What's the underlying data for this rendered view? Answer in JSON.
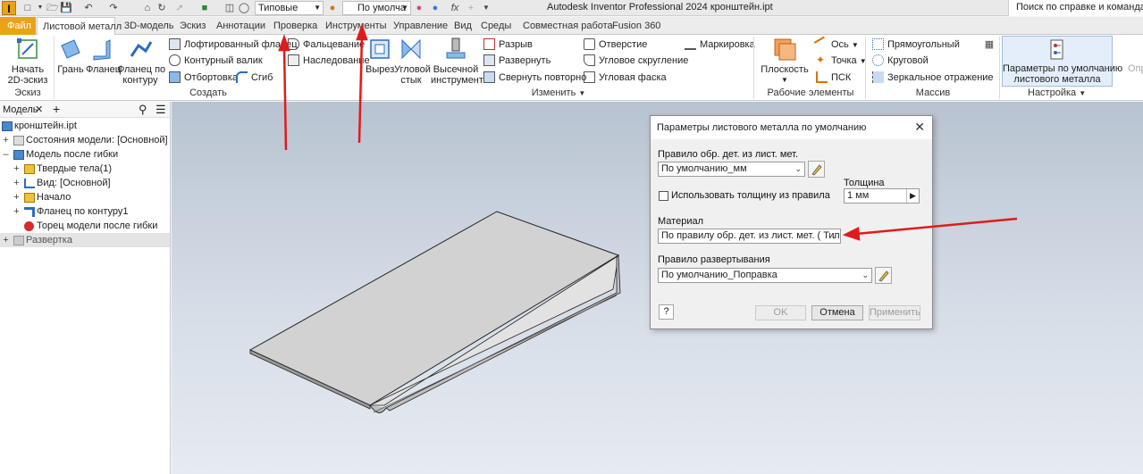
{
  "quick_access": {
    "logo": "I",
    "appearance_value": "Типовые",
    "material_value": "По умолча",
    "title": "Autodesk Inventor Professional 2024   кронштейн.ipt",
    "help_search": "Поиск по справке и командам."
  },
  "tabs": [
    {
      "label": "Файл"
    },
    {
      "label": "Листовой металл"
    },
    {
      "label": "3D-модель"
    },
    {
      "label": "Эскиз"
    },
    {
      "label": "Аннотации"
    },
    {
      "label": "Проверка"
    },
    {
      "label": "Инструменты"
    },
    {
      "label": "Управление"
    },
    {
      "label": "Вид"
    },
    {
      "label": "Среды"
    },
    {
      "label": "Совместная работа"
    },
    {
      "label": "Fusion 360"
    }
  ],
  "ribbon": {
    "sketch_panel": {
      "start_sketch": "Начать\n2D-эскиз",
      "label": "Эскиз"
    },
    "create_panel": {
      "label": "Создать",
      "face": "Грань",
      "flange": "Фланец",
      "contour_flange": "Фланец по\nконтуру",
      "lofted_flange": "Лофтированный фланец",
      "contour_roll": "Контурный валик",
      "rip": "Отбортовка",
      "bend": "Сгиб",
      "hem": "Фальцевание",
      "derive": "Наследование"
    },
    "modify_panel": {
      "label": "Изменить",
      "cut": "Вырез",
      "corner_seam": "Угловой\nстык",
      "punch_tool": "Высечной\nинструмент",
      "rip": "Разрыв",
      "unfold": "Развернуть",
      "refold": "Свернуть повторно",
      "hole": "Отверстие",
      "corner_round": "Угловое скругление",
      "corner_chamfer": "Угловая фаска",
      "mark": "Маркировка"
    },
    "work_features_panel": {
      "label": "Рабочие элементы",
      "plane": "Плоскость",
      "axis": "Ось",
      "point": "Точка",
      "ucs": "ПСК"
    },
    "pattern_panel": {
      "label": "Массив",
      "rectangular": "Прямоугольный",
      "circular": "Круговой",
      "mirror": "Зеркальное отражение"
    },
    "setup_panel": {
      "label": "Настройка",
      "sheet_metal_defaults": "Параметры по умолчанию\nлистового металла",
      "cut_off": "Опр"
    }
  },
  "browser": {
    "tab_label": "Модель",
    "rows": [
      {
        "label": "кронштейн.ipt"
      },
      {
        "label": "Состояния модели: [Основной]"
      },
      {
        "label": "Модель после гибки"
      },
      {
        "label": "Твердые тела(1)"
      },
      {
        "label": "Вид: [Основной]"
      },
      {
        "label": "Начало"
      },
      {
        "label": "Фланец по контуру1"
      },
      {
        "label": "Торец модели после гибки"
      },
      {
        "label": "Развертка"
      }
    ]
  },
  "dialog": {
    "title": "Параметры листового металла по умолчанию",
    "rule_label": "Правило обр. дет. из лист. мет.",
    "rule_value": "По умолчанию_мм",
    "use_thickness_label": "Использовать толщину из правила",
    "use_thickness_checked": false,
    "thickness_label": "Толщина",
    "thickness_value": "1 мм",
    "material_label": "Материал",
    "material_value": "По правилу обр. дет. из лист. мет. ( Типовые",
    "unfold_rule_label": "Правило развертывания",
    "unfold_rule_value": "По умолчанию_Поправка",
    "ok": "OK",
    "cancel": "Отмена",
    "apply": "Применить",
    "help": "?"
  },
  "colors": {
    "annotation_arrow": "#e01b1b",
    "file_tab": "#e8a317",
    "accent": "#2b6cc4"
  }
}
